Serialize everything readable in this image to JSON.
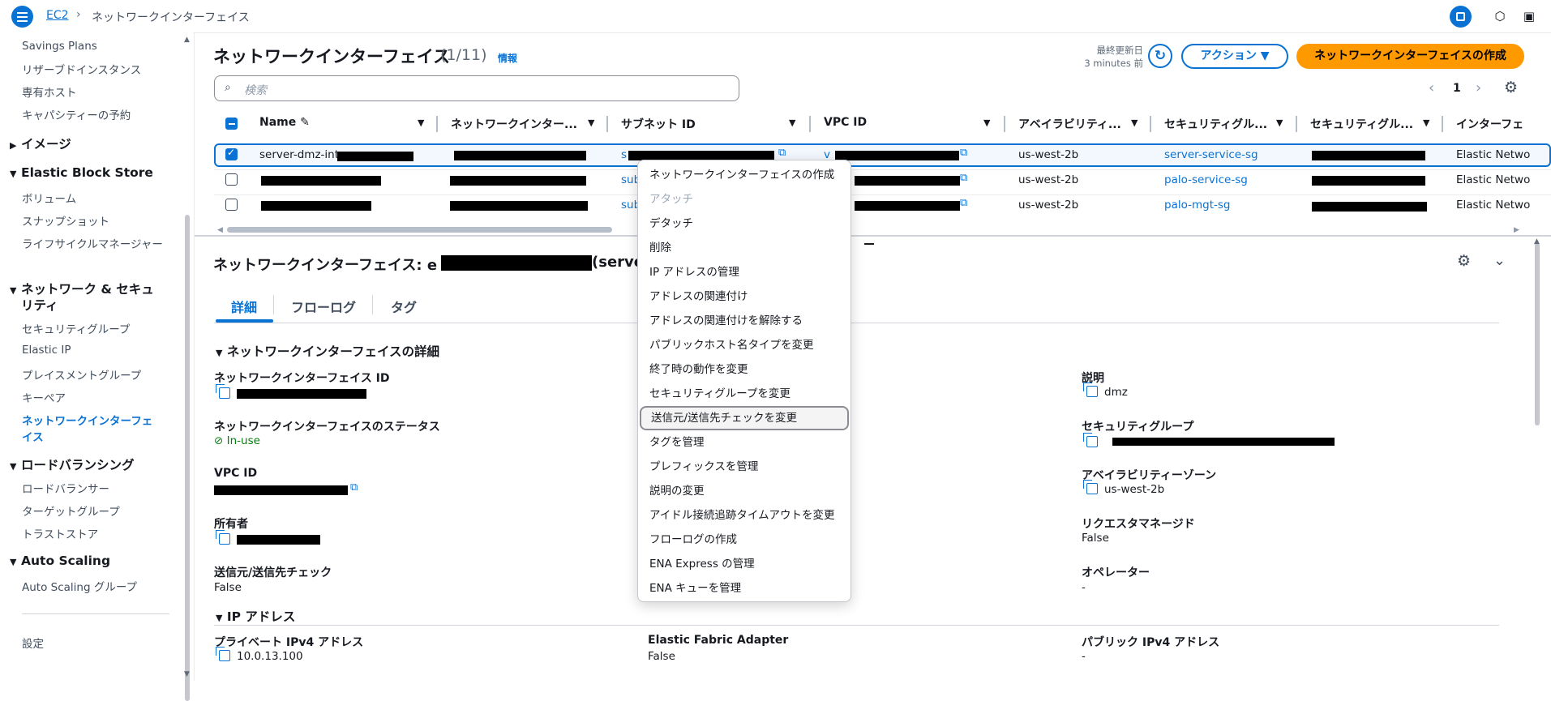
{
  "breadcrumb": {
    "root": "EC2",
    "current": "ネットワークインターフェイス"
  },
  "sidebar": {
    "items_top": [
      "Savings Plans",
      "リザーブドインスタンス",
      "専有ホスト",
      "キャパシティーの予約"
    ],
    "sections": [
      {
        "title": "イメージ",
        "items": []
      },
      {
        "title": "Elastic Block Store",
        "items": [
          "ボリューム",
          "スナップショット",
          "ライフサイクルマネージャー"
        ]
      },
      {
        "title_line1": "ネットワーク & セキュ",
        "title_line2": "リティ",
        "items": [
          "セキュリティグループ",
          "Elastic IP",
          "プレイスメントグループ",
          "キーペア"
        ],
        "active_line1": "ネットワークインターフェ",
        "active_line2": "イス"
      },
      {
        "title": "ロードバランシング",
        "items": [
          "ロードバランサー",
          "ターゲットグループ",
          "トラストストア"
        ]
      },
      {
        "title": "Auto Scaling",
        "items": [
          "Auto Scaling グループ"
        ]
      }
    ],
    "settings": "設定"
  },
  "list": {
    "title": "ネットワークインターフェイス",
    "count": "(1/11)",
    "info": "情報",
    "last_updated_label": "最終更新日",
    "last_updated_value": "3 minutes 前",
    "actions_button": "アクション",
    "create_button": "ネットワークインターフェイスの作成",
    "search_placeholder": "検索",
    "page": "1",
    "columns": [
      "Name",
      "ネットワークインター...",
      "サブネット ID",
      "VPC ID",
      "アベイラビリティ...",
      "セキュリティグル...",
      "セキュリティグル...",
      "インターフェ"
    ],
    "rows": [
      {
        "name": "server-dmz-int-",
        "subnet": "s",
        "vpc": "v",
        "az": "us-west-2b",
        "sg": "server-service-sg",
        "type": "Elastic Netwo"
      },
      {
        "name": "",
        "subnet": "sub",
        "vpc": "",
        "az": "us-west-2b",
        "sg": "palo-service-sg",
        "type": "Elastic Netwo"
      },
      {
        "name": "",
        "subnet": "sub",
        "vpc": "",
        "az": "us-west-2b",
        "sg": "palo-mgt-sg",
        "type": "Elastic Netwo"
      }
    ]
  },
  "context_menu": {
    "items": [
      "ネットワークインターフェイスの作成",
      "アタッチ",
      "デタッチ",
      "削除",
      "IP アドレスの管理",
      "アドレスの関連付け",
      "アドレスの関連付けを解除する",
      "パブリックホスト名タイプを変更",
      "終了時の動作を変更",
      "セキュリティグループを変更",
      "送信元/送信先チェックを変更",
      "タグを管理",
      "プレフィックスを管理",
      "説明の変更",
      "アイドル接続追跡タイムアウトを変更",
      "フローログの作成",
      "ENA Express の管理",
      "ENA キューを管理"
    ],
    "disabled_item": "アタッチ",
    "hovered_item": "送信元/送信先チェックを変更"
  },
  "detail": {
    "title_prefix": "ネットワークインターフェイス: e",
    "title_suffix": "(server",
    "tabs": [
      "詳細",
      "フローログ",
      "タグ"
    ],
    "section_title": "ネットワークインターフェイスの詳細",
    "fields": {
      "eni_id_label": "ネットワークインターフェイス ID",
      "status_label": "ネットワークインターフェイスのステータス",
      "status_value": "In-use",
      "vpc_label": "VPC ID",
      "owner_label": "所有者",
      "srcdst_label": "送信元/送信先チェック",
      "srcdst_value": "False",
      "desc_label": "説明",
      "desc_value": "dmz",
      "sg_label": "セキュリティグループ",
      "az_label": "アベイラビリティーゾーン",
      "az_value": "us-west-2b",
      "requester_label": "リクエスタマネージド",
      "requester_value": "False",
      "operator_label": "オペレーター",
      "operator_value": "-"
    },
    "ip_section_title": "IP アドレス",
    "ip": {
      "private_label": "プライベート IPv4 アドレス",
      "private_value": "10.0.13.100",
      "efa_label": "Elastic Fabric Adapter",
      "efa_value": "False",
      "public_label": "パブリック IPv4 アドレス",
      "public_value": "-"
    }
  }
}
